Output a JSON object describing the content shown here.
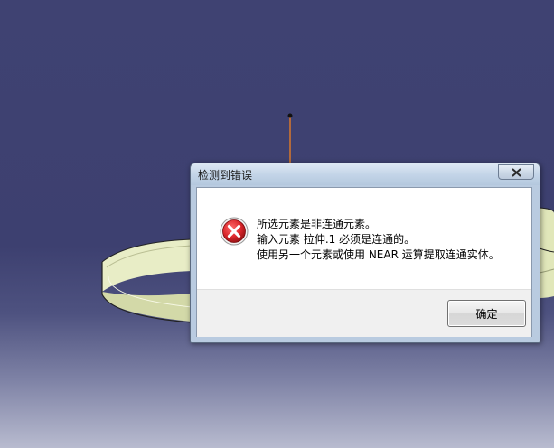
{
  "dialog": {
    "title": "检测到错误",
    "close_icon": "close-icon",
    "status_icon": "error-icon",
    "status_color": "#d9252a",
    "message_lines": [
      "所选元素是非连通元素。",
      "输入元素 拉伸.1 必须是连通的。",
      "使用另一个元素或使用 NEAR 运算提取连通实体。"
    ],
    "ok_label": "确定"
  },
  "viewport": {
    "background_color": "#3f4272",
    "part_color": "#e6ecc0"
  }
}
